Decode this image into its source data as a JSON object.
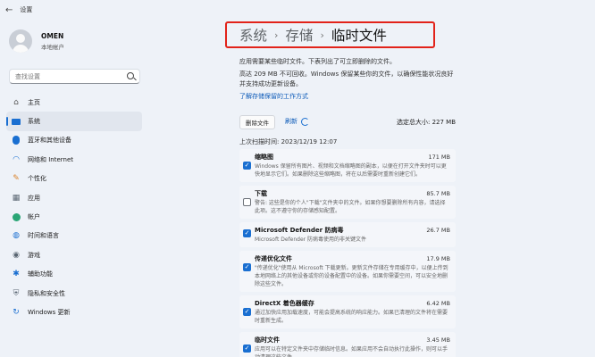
{
  "window": {
    "title": "设置"
  },
  "account": {
    "name": "OMEN",
    "type": "本地帐户"
  },
  "search": {
    "placeholder": "查找设置"
  },
  "nav": [
    {
      "label": "主页",
      "icon": "home-icon"
    },
    {
      "label": "系统",
      "icon": "monitor-icon",
      "active": true
    },
    {
      "label": "蓝牙和其他设备",
      "icon": "bluetooth-icon"
    },
    {
      "label": "网络和 Internet",
      "icon": "wifi-icon"
    },
    {
      "label": "个性化",
      "icon": "brush-icon"
    },
    {
      "label": "应用",
      "icon": "apps-icon"
    },
    {
      "label": "帐户",
      "icon": "person-icon"
    },
    {
      "label": "时间和语言",
      "icon": "globe-icon"
    },
    {
      "label": "游戏",
      "icon": "gamepad-icon"
    },
    {
      "label": "辅助功能",
      "icon": "accessibility-icon"
    },
    {
      "label": "隐私和安全性",
      "icon": "shield-icon"
    },
    {
      "label": "Windows 更新",
      "icon": "update-icon"
    }
  ],
  "breadcrumb": {
    "part1": "系统",
    "part2": "存储",
    "current": "临时文件"
  },
  "description": "应用需要某些临时文件。下表列出了可立即删除的文件。",
  "warning": "高达 209 MB 不可回收。Windows 保留某些你的文件，以确保性能状况良好并支持成功更新设备。",
  "link": "了解存储保留的工作方式",
  "toolbar": {
    "delete_label": "删除文件",
    "refresh_label": "刷新",
    "total": "选定总大小: 227 MB"
  },
  "last_scan": "上次扫描时间: 2023/12/19 12:07",
  "items": [
    {
      "title": "缩略图",
      "size": "171 MB",
      "checked": true,
      "desc": "Windows 保留所有图片、视频和文档缩略图的副本，以便在打开文件夹时可以更快地显示它们。如果删除这些缩略图，将在以后需要时重新创建它们。"
    },
    {
      "title": "下载",
      "size": "85.7 MB",
      "checked": false,
      "desc": "警告: 这些是你的个人\"下载\"文件夹中的文件。如果你想要删除所有内容，请选择此项。这不遵守你的存储感知配置。"
    },
    {
      "title": "Microsoft Defender 防病毒",
      "size": "26.7 MB",
      "checked": true,
      "desc": "Microsoft Defender 防病毒使用的非关键文件"
    },
    {
      "title": "传递优化文件",
      "size": "17.9 MB",
      "checked": true,
      "desc": "\"传递优化\"使用从 Microsoft 下载更新。更新文件存储在专用缓存中，以便上传到本地网络上的其他设备或你的设备配置中的设备。如果你需要空间，可以安全地删除这些文件。"
    },
    {
      "title": "DirectX 着色器缓存",
      "size": "6.42 MB",
      "checked": true,
      "desc": "通过加快应用加载速度，可能会提高系统的响应能力。如果已清理的文件将在需要时重新生成。"
    },
    {
      "title": "临时文件",
      "size": "3.45 MB",
      "checked": true,
      "desc": "应用可以在特定文件夹中存储临时信息。如果应用不会自动执行此操作，则可以手动清理这些文件。"
    }
  ]
}
